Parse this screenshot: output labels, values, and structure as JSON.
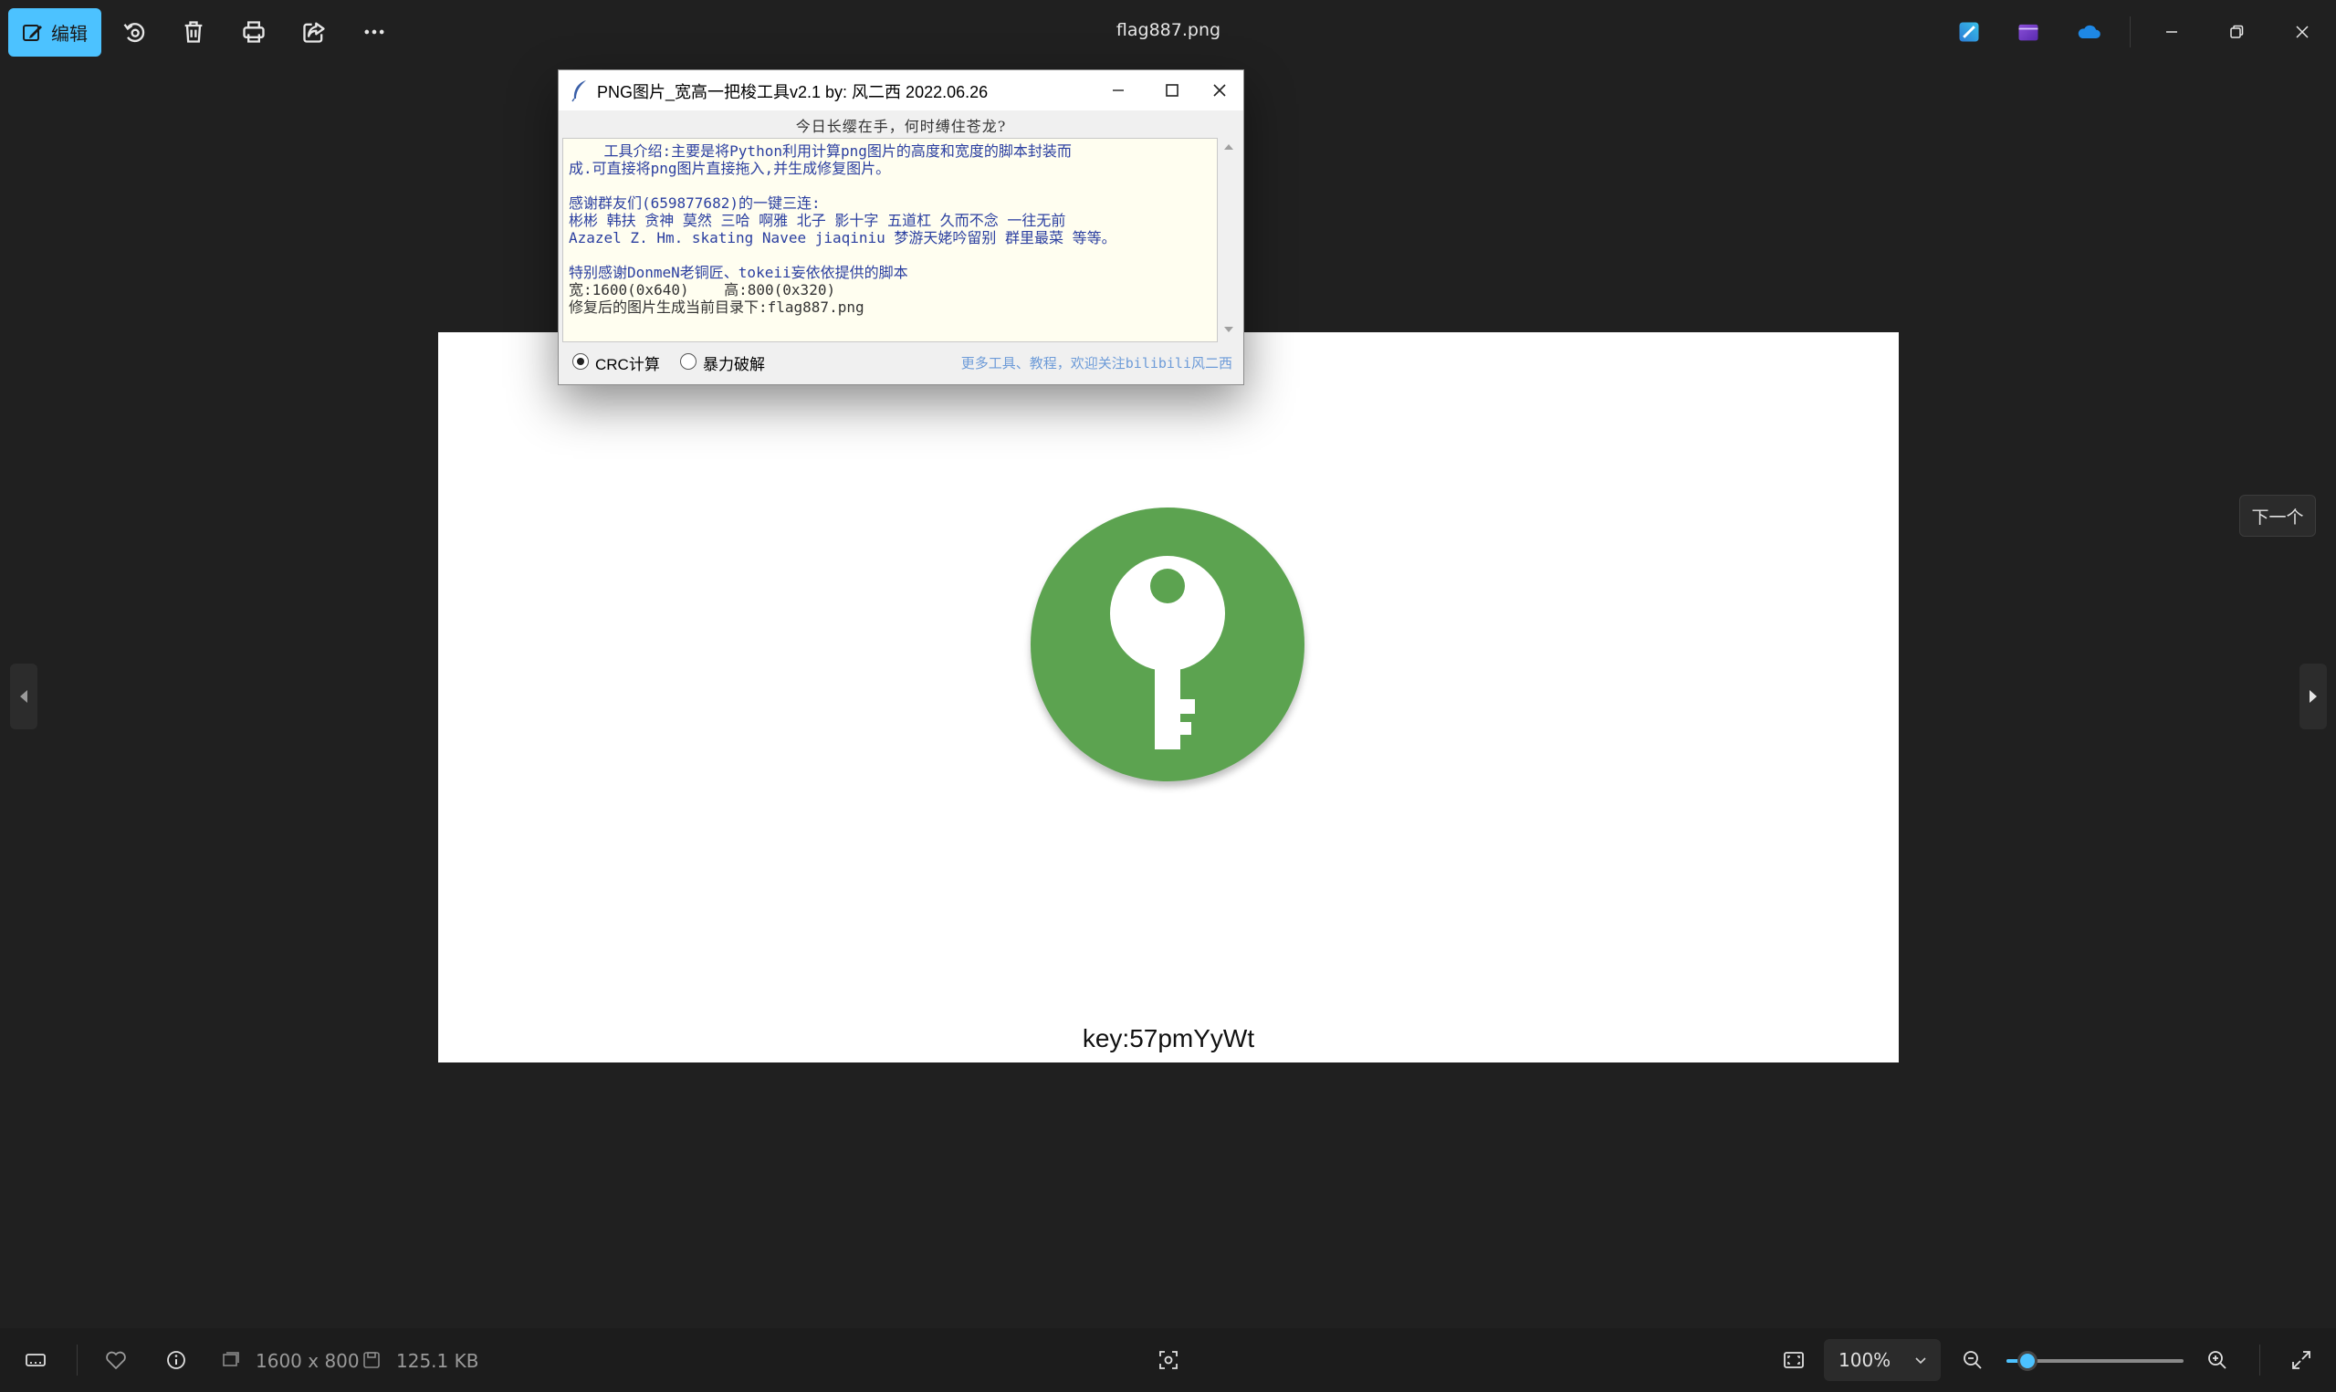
{
  "window": {
    "file_name": "flag887.png"
  },
  "toolbar": {
    "edit_label": "编辑",
    "icons": [
      "edit-icon",
      "rotate-icon",
      "delete-icon",
      "print-icon",
      "share-icon",
      "more-icon"
    ],
    "app_icons": [
      "designer-icon",
      "clipchamp-icon",
      "onedrive-icon"
    ]
  },
  "viewer": {
    "caption": "key:57pmYyWt",
    "next_tooltip": "下一个"
  },
  "dialog": {
    "title": "PNG图片_宽高一把梭工具v2.1   by: 风二西 2022.06.26",
    "motto": "今日长缨在手，何时缚住苍龙?",
    "lines": [
      "    工具介绍:主要是将Python利用计算png图片的高度和宽度的脚本封装而",
      "成.可直接将png图片直接拖入,并生成修复图片。",
      "",
      "感谢群友们(659877682)的一键三连:",
      "彬彬 韩扶 贪神 莫然 三哈 啊雅 北子 影十字 五道杠 久而不念 一往无前",
      "Azazel Z. Hm. skating Navee jiaqiniu 梦游天姥吟留别 群里最菜 等等。",
      "",
      "特别感谢DonmeN老铜匠、tokeii妄依依提供的脚本",
      "宽:1600(0x640)    高:800(0x320)",
      "修复后的图片生成当前目录下:flag887.png"
    ],
    "radio_crc": "CRC计算",
    "radio_brute": "暴力破解",
    "selected": "CRC计算",
    "promo": "更多工具、教程，欢迎关注bilibili风二西"
  },
  "bottom": {
    "dimensions": "1600 x 800",
    "file_size": "125.1 KB",
    "zoom_label": "100%",
    "zoom_level": 0.12
  }
}
